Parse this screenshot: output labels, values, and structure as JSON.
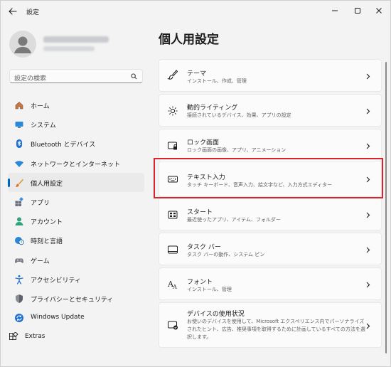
{
  "window": {
    "title": "設定",
    "controls": [
      "minimize-icon",
      "maximize-icon",
      "close-icon"
    ]
  },
  "sidebar": {
    "search_placeholder": "設定の検索",
    "items": [
      {
        "label": "ホーム",
        "icon": "home-icon",
        "selected": false
      },
      {
        "label": "システム",
        "icon": "system-monitor-icon",
        "selected": false
      },
      {
        "label": "Bluetooth とデバイス",
        "icon": "bluetooth-icon",
        "selected": false
      },
      {
        "label": "ネットワークとインターネット",
        "icon": "wifi-icon",
        "selected": false
      },
      {
        "label": "個人用設定",
        "icon": "paintbrush-icon",
        "selected": true
      },
      {
        "label": "アプリ",
        "icon": "apps-icon",
        "selected": false
      },
      {
        "label": "アカウント",
        "icon": "account-icon",
        "selected": false
      },
      {
        "label": "時刻と言語",
        "icon": "globe-clock-icon",
        "selected": false
      },
      {
        "label": "ゲーム",
        "icon": "gamepad-icon",
        "selected": false
      },
      {
        "label": "アクセシビリティ",
        "icon": "accessibility-icon",
        "selected": false
      },
      {
        "label": "プライバシーとセキュリティ",
        "icon": "shield-icon",
        "selected": false
      },
      {
        "label": "Windows Update",
        "icon": "windows-update-icon",
        "selected": false
      },
      {
        "label": "Extras",
        "icon": "extras-grid-icon",
        "selected": false
      }
    ]
  },
  "main": {
    "page_title": "個人用設定",
    "cards": [
      {
        "title": "テーマ",
        "desc": "インストール、作成、管理",
        "icon": "theme-brush-icon"
      },
      {
        "title": "動的ライティング",
        "desc": "接続されているデバイス、効果、アプリの設定",
        "icon": "dynamic-lighting-icon"
      },
      {
        "title": "ロック画面",
        "desc": "ロック画面の画像、アプリ、アニメーション",
        "icon": "lock-screen-icon"
      },
      {
        "title": "テキスト入力",
        "desc": "タッチ キーボード、音声入力、絵文字など、入力方式エディター",
        "icon": "keyboard-icon"
      },
      {
        "title": "スタート",
        "desc": "最近使ったアプリ、アイテム、フォルダー",
        "icon": "start-menu-icon"
      },
      {
        "title": "タスク バー",
        "desc": "タスク バーの動作、システム ピン",
        "icon": "taskbar-icon"
      },
      {
        "title": "フォント",
        "desc": "インストール、管理",
        "icon": "font-icon"
      },
      {
        "title": "デバイスの使用状況",
        "desc": "お使いのデバイスを使用して、Microsoft エクスペリエンス内でパーソナライズされたヒント、広告、推奨事項を取得するために計画しているすべての方法を選択します。",
        "icon": "device-usage-icon"
      }
    ]
  },
  "colors": {
    "accent": "#0067c0",
    "highlight_border": "#d9232d"
  }
}
